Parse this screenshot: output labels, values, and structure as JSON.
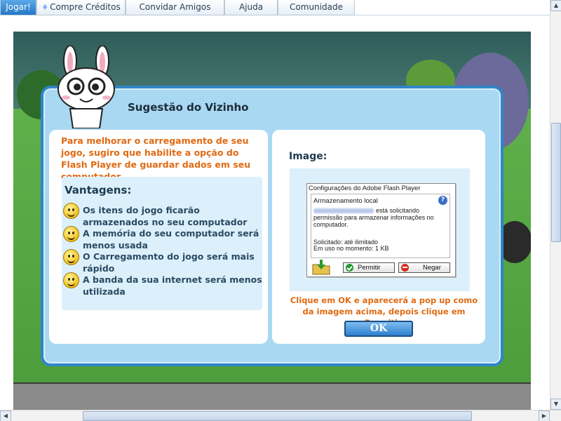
{
  "nav": {
    "tabs": [
      {
        "label": "Jogar!"
      },
      {
        "label": "Compre Créditos"
      },
      {
        "label": "Convidar Amigos"
      },
      {
        "label": "Ajuda"
      },
      {
        "label": "Comunidade"
      }
    ]
  },
  "dialog": {
    "title": "Sugestão do Vizinho",
    "intro": "Para melhorar o carregamento de seu jogo, sugiro que habilite a opção do Flash Player de guardar dados em seu computador.",
    "advantages_title": "Vantagens:",
    "advantages": [
      "Os itens do jogo ficarão armazenados no seu computador",
      "A memória do seu computador será menos usada",
      "O Carregamento do jogo será mais rápido",
      "A banda da sua internet será menos utilizada"
    ],
    "image_label": "Image:",
    "flash": {
      "title": "Configurações do Adobe Flash Player",
      "section": "Armazenamento local",
      "help": "?",
      "message_tail": "está solicitando",
      "message_rest": "permissão para armazenar informações no computador.",
      "requested": "Solicitado: até ilimitado",
      "in_use": "Em uso no momento: 1 KB",
      "allow": "Permitir",
      "deny": "Negar"
    },
    "instructions": "Clique em OK e aparecerá a pop up como da imagem acima, depois clique em Permitir.",
    "ok_label": "OK"
  },
  "colors": {
    "accent": "#2f86c7",
    "highlight_text": "#e06a12",
    "dialog_bg": "#a9d8f2"
  }
}
